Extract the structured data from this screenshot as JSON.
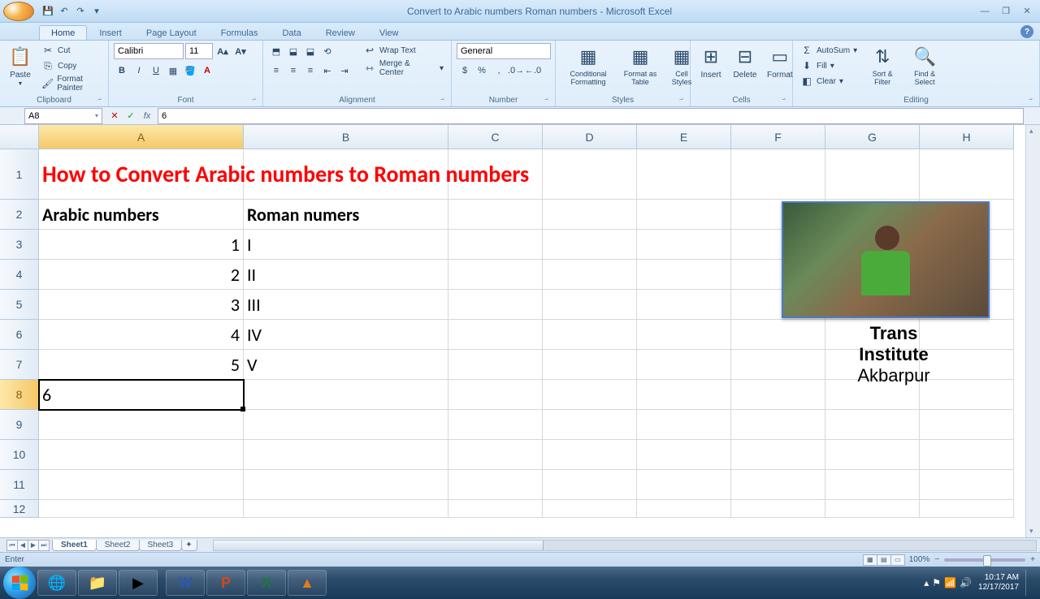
{
  "title": "Convert  to Arabic numbers Roman numbers - Microsoft Excel",
  "qat": [
    "save-icon",
    "undo-icon",
    "redo-icon"
  ],
  "tabs": [
    "Home",
    "Insert",
    "Page Layout",
    "Formulas",
    "Data",
    "Review",
    "View"
  ],
  "active_tab": 0,
  "ribbon": {
    "clipboard": {
      "label": "Clipboard",
      "paste": "Paste",
      "cut": "Cut",
      "copy": "Copy",
      "format_painter": "Format Painter"
    },
    "font": {
      "label": "Font",
      "name": "Calibri",
      "size": "11",
      "bold": "B",
      "italic": "I",
      "underline": "U"
    },
    "alignment": {
      "label": "Alignment",
      "wrap": "Wrap Text",
      "merge": "Merge & Center"
    },
    "number": {
      "label": "Number",
      "format": "General"
    },
    "styles": {
      "label": "Styles",
      "cond": "Conditional Formatting",
      "table": "Format as Table",
      "cell": "Cell Styles"
    },
    "cells": {
      "label": "Cells",
      "insert": "Insert",
      "delete": "Delete",
      "format": "Format"
    },
    "editing": {
      "label": "Editing",
      "autosum": "AutoSum",
      "fill": "Fill",
      "clear": "Clear",
      "sort": "Sort & Filter",
      "find": "Find & Select"
    }
  },
  "name_box": "A8",
  "formula_value": "6",
  "columns": [
    "A",
    "B",
    "C",
    "D",
    "E",
    "F",
    "G",
    "H"
  ],
  "rows": [
    "1",
    "2",
    "3",
    "4",
    "5",
    "6",
    "7",
    "8",
    "9",
    "10",
    "11",
    "12"
  ],
  "selected_col": 0,
  "selected_row": 7,
  "data": {
    "title_text": "How to Convert  Arabic numbers to Roman numbers",
    "h_arabic": "Arabic numbers",
    "h_roman": "Roman numers",
    "rows": [
      {
        "a": "1",
        "b": "I"
      },
      {
        "a": "2",
        "b": "II"
      },
      {
        "a": "3",
        "b": "III"
      },
      {
        "a": "4",
        "b": "IV"
      },
      {
        "a": "5",
        "b": "V"
      }
    ],
    "editing": "6"
  },
  "caption": {
    "l1": "Trans",
    "l2": "Institute",
    "l3": "Akbarpur"
  },
  "sheets": [
    "Sheet1",
    "Sheet2",
    "Sheet3"
  ],
  "active_sheet": 0,
  "status": "Enter",
  "zoom": "100%",
  "clock": {
    "time": "10:17 AM",
    "date": "12/17/2017"
  }
}
